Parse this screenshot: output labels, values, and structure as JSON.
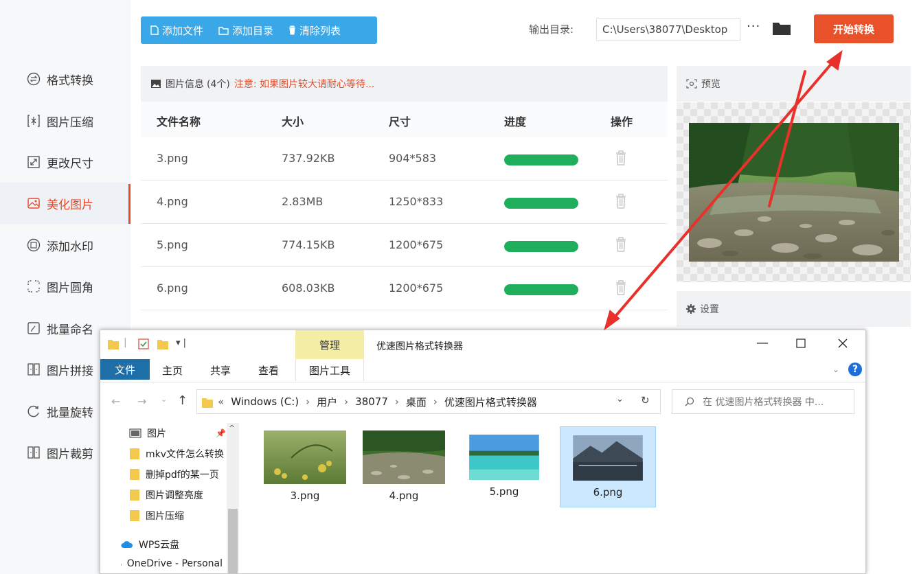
{
  "sidebar": {
    "items": [
      {
        "label": "格式转换",
        "icon": "format-convert-icon"
      },
      {
        "label": "图片压缩",
        "icon": "compress-icon"
      },
      {
        "label": "更改尺寸",
        "icon": "resize-icon"
      },
      {
        "label": "美化图片",
        "icon": "beautify-icon",
        "active": true
      },
      {
        "label": "添加水印",
        "icon": "watermark-icon"
      },
      {
        "label": "图片圆角",
        "icon": "round-corner-icon"
      },
      {
        "label": "批量命名",
        "icon": "rename-icon"
      },
      {
        "label": "图片拼接",
        "icon": "stitch-icon"
      },
      {
        "label": "批量旋转",
        "icon": "rotate-icon"
      },
      {
        "label": "图片裁剪",
        "icon": "crop-icon"
      }
    ]
  },
  "toolbar": {
    "add_file": "添加文件",
    "add_folder": "添加目录",
    "clear_list": "清除列表",
    "output_label": "输出目录:",
    "output_path": "C:\\Users\\38077\\Desktop",
    "more": "···",
    "start": "开始转换",
    "accent": "#3aa7e8",
    "start_color": "#e8512a"
  },
  "table": {
    "info_title": "图片信息",
    "count": "(4个)",
    "warning": "注意: 如果图片较大请耐心等待...",
    "headers": [
      "文件名称",
      "大小",
      "尺寸",
      "进度",
      "操作"
    ],
    "rows": [
      {
        "name": "3.png",
        "size": "737.92KB",
        "dims": "904*583",
        "progress": 1.0
      },
      {
        "name": "4.png",
        "size": "2.83MB",
        "dims": "1250*833",
        "progress": 1.0
      },
      {
        "name": "5.png",
        "size": "774.15KB",
        "dims": "1200*675",
        "progress": 1.0
      },
      {
        "name": "6.png",
        "size": "608.03KB",
        "dims": "1200*675",
        "progress": 1.0
      }
    ],
    "progress_color": "#1fae5b"
  },
  "preview": {
    "title": "预览"
  },
  "settings": {
    "title": "设置"
  },
  "explorer": {
    "qat": "▾ |",
    "manage": "管理",
    "window_title": "优速图片格式转换器",
    "tabs": {
      "file": "文件",
      "home": "主页",
      "share": "共享",
      "view": "查看",
      "picture_tools": "图片工具"
    },
    "address": [
      "«",
      "Windows (C:)",
      "›",
      "用户",
      "›",
      "38077",
      "›",
      "桌面",
      "›",
      "优速图片格式转换器"
    ],
    "search_placeholder": "在 优速图片格式转换器 中...",
    "nav": [
      {
        "label": "图片",
        "icon": "pictures-icon"
      },
      {
        "label": "mkv文件怎么转换",
        "icon": "folder-icon"
      },
      {
        "label": "删掉pdf的某一页",
        "icon": "folder-icon"
      },
      {
        "label": "图片调整亮度",
        "icon": "folder-icon"
      },
      {
        "label": "图片压缩",
        "icon": "folder-icon"
      },
      {
        "label": "WPS云盘",
        "icon": "cloud-icon"
      },
      {
        "label": "OneDrive - Personal",
        "icon": "onedrive-icon"
      }
    ],
    "files": [
      {
        "name": "3.png"
      },
      {
        "name": "4.png"
      },
      {
        "name": "5.png"
      },
      {
        "name": "6.png",
        "selected": true
      }
    ]
  }
}
